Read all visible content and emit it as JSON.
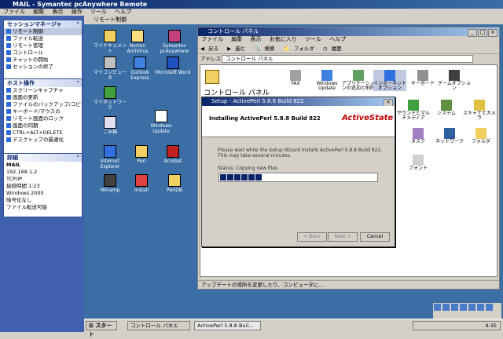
{
  "outer": {
    "title": "MAIL - Symantec pcAnywhere Remote",
    "menu": [
      "ファイル",
      "編集",
      "表示",
      "操作",
      "ツール",
      "ヘルプ"
    ]
  },
  "sidebar": {
    "panel1": {
      "title": "セッションマネージャ",
      "items": [
        "リモート制御",
        "ファイル転送",
        "リモート管理",
        "コントロール",
        "チャットの開始",
        "セッションの終了"
      ]
    },
    "panel2": {
      "title": "ホスト操作",
      "items": [
        "スクリーンキャプチャ",
        "画面の更新",
        "ファイルのバックアップ/コピーの",
        "キーボード/マウスの",
        "リモート画面のロック",
        "画面の同期",
        "CTRL+ALT+DELETE",
        "デスクトップの最適化"
      ]
    },
    "panel3": {
      "title": "詳細",
      "lines": [
        "MAIL",
        "192.168.1.2",
        "TCP/IP",
        "接続時間 1:23",
        "Windows 2000",
        "暗号化なし",
        "ファイル転送可能",
        "接続 0:28:31"
      ]
    }
  },
  "desktop": {
    "topbar": "リモート制御",
    "icons": [
      "マイドキュメント",
      "Norton AntiVirus",
      "Symantec pcAnywhere",
      "マイコンピュータ",
      "Outlook Express",
      "Microsoft Word",
      "マイネットワーク",
      "ごみ箱",
      "Internet Explorer",
      "Windows Update",
      "Perl",
      "Acrobat",
      "Winamp",
      "Install",
      "PerlDB"
    ]
  },
  "control_panel": {
    "title": "コントロール パネル",
    "menu": [
      "ファイル",
      "編集",
      "表示",
      "お気に入り",
      "ツール",
      "ヘルプ"
    ],
    "toolbar": [
      "戻る",
      "進む",
      "検索",
      "フォルダ",
      "履歴"
    ],
    "address_label": "アドレス",
    "address_value": "コントロール パネル",
    "pane_title": "コントロール パネル",
    "icons": [
      "FAX",
      "Windows Update",
      "アプリケーションの追加と削除",
      "インターネットオプション",
      "キーボード",
      "ゲームオプション",
      "サウンドとマルチメディア",
      "システム",
      "スキャナとカメラ",
      "タスク",
      "ネットワーク",
      "フォルダ",
      "フォント",
      "プリンタ",
      "ユーザー",
      "地域のオプション",
      "日付と時刻"
    ],
    "status": "アップデートの場所を変更したり、コンピュータに..."
  },
  "installer": {
    "title": "Setup - ActivePerl 5.8.8 Build 822",
    "heading": "Installing ActivePerl 5.8.8 Build 822",
    "brand": "ActiveState",
    "description": "Please wait while the Setup Wizard installs ActivePerl 5.8.8 Build 822. This may take several minutes.",
    "status": "Status: Copying new files",
    "progress": 0.25,
    "buttons": {
      "back": "< Back",
      "next": "Next >",
      "cancel": "Cancel"
    }
  },
  "taskbar": {
    "start": "スタート",
    "buttons": [
      "コントロール パネル",
      "ActivePerl 5.8.8 Buil..."
    ],
    "time": "4:35"
  }
}
